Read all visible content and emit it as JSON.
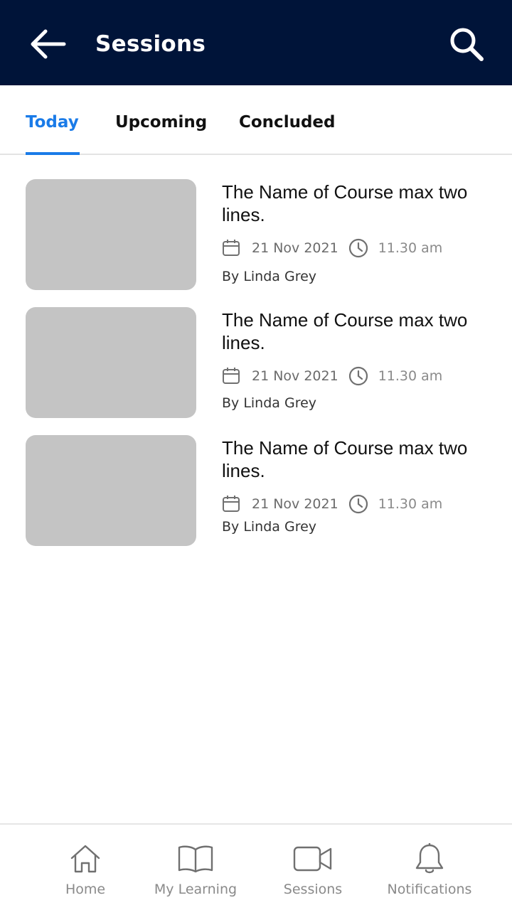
{
  "header": {
    "title": "Sessions",
    "back_icon": "arrow-left-icon",
    "search_icon": "search-icon",
    "background": "#001439"
  },
  "tabs": [
    {
      "label": "Today",
      "active": true
    },
    {
      "label": "Upcoming",
      "active": false
    },
    {
      "label": "Concluded",
      "active": false
    }
  ],
  "accent_color": "#1a7be8",
  "sessions": [
    {
      "title": "The Name of Course max two lines.",
      "date": "21 Nov 2021",
      "time": "11.30 am",
      "by": "By Linda Grey"
    },
    {
      "title": "The Name of Course max two lines.",
      "date": "21 Nov 2021",
      "time": "11.30 am",
      "by": "By Linda Grey"
    },
    {
      "title": "The Name of Course max two lines.",
      "date": "21 Nov 2021",
      "time": "11.30 am",
      "by": "By Linda Grey"
    }
  ],
  "bottom_nav": [
    {
      "label": "Home",
      "icon": "home-icon"
    },
    {
      "label": "My Learning",
      "icon": "book-icon"
    },
    {
      "label": "Sessions",
      "icon": "video-camera-icon"
    },
    {
      "label": "Notifications",
      "icon": "bell-icon"
    }
  ]
}
